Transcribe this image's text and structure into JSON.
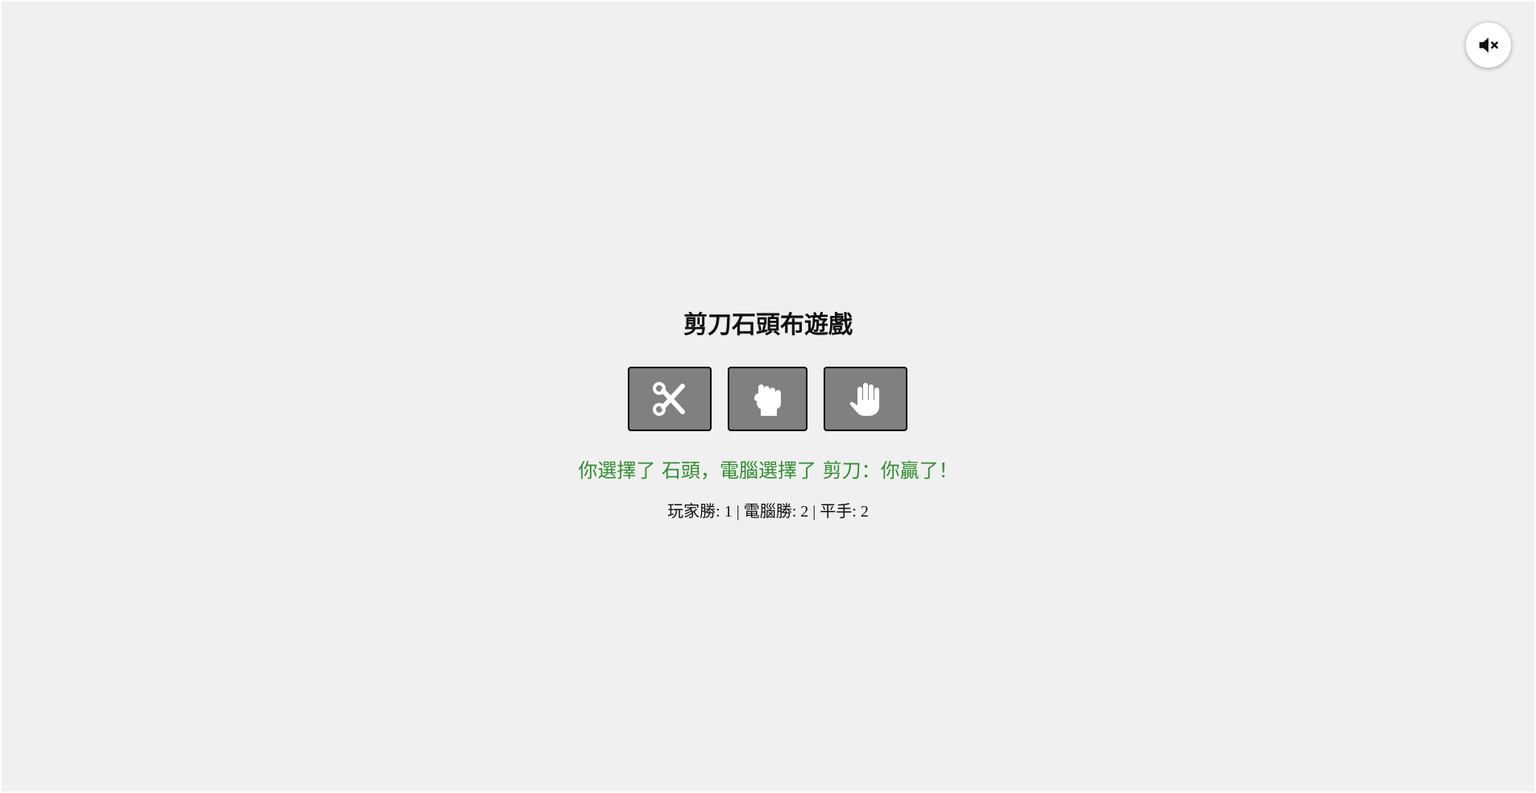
{
  "audio": {
    "icon": "volume-mute-icon"
  },
  "game": {
    "title": "剪刀石頭布遊戲",
    "choices": [
      {
        "name": "剪刀",
        "icon": "scissors-icon"
      },
      {
        "name": "石頭",
        "icon": "rock-fist-icon"
      },
      {
        "name": "布",
        "icon": "paper-hand-icon"
      }
    ],
    "result_text": "你選擇了 石頭，電腦選擇了 剪刀：你贏了！",
    "score_text": "玩家勝: 1 | 電腦勝: 2 | 平手: 2"
  },
  "colors": {
    "background": "#f0f0f0",
    "button_fill": "#808080",
    "result_win": "#2f8f2f"
  }
}
